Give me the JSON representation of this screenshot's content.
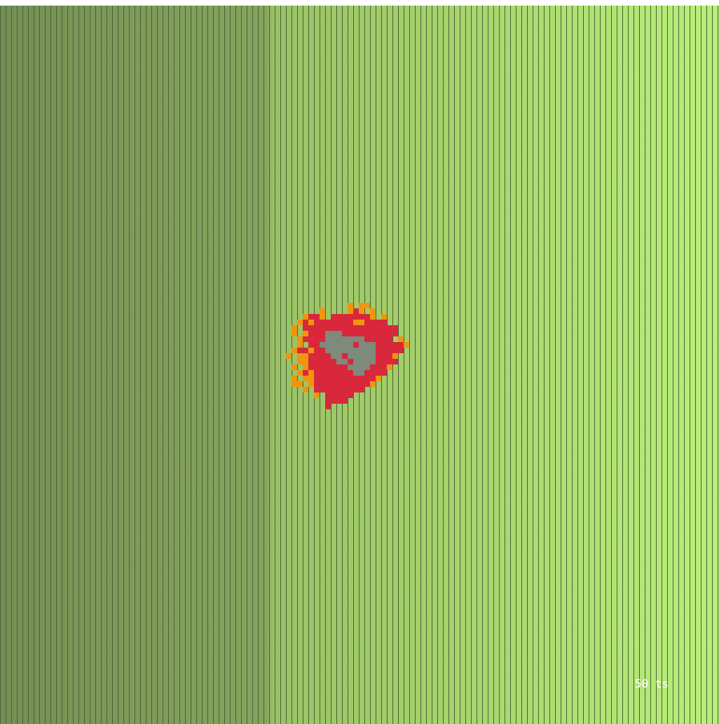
{
  "status": {
    "ticks": "50 ts"
  },
  "fire_grid": {
    "rows": [
      "............O.OO........",
      ".......O....ORO.O.......",
      "....ORRO.RRRRRRRO.O.....",
      "...ORORRRRRRROORRRR.....",
      "..O.RRRRRRRRRRRRRRRRR...",
      "..O.ORRRAAARRRRRRRRRR...",
      "...ORRRRAAAAAAARRRRR.O..",
      "...O.RRAAAAAARAAARRRRRO.",
      "..ORRORRAAAAAAAAARRRRR..",
      ".O.OORRRRAARAAAAARRRO...",
      "...OORRRRRAARAAAARRRR...",
      "..O.ORRRRRRRAAAARRRO....",
      "...ORORRRRRRRAARRRR.....",
      "..O.OORRRRRRRRRRRO......",
      "..OO.ORRRRRRRRRRO.......",
      "....O.RRRRRRRRR.........",
      "......O.RRRRR...........",
      "........RRRR............",
      "........R..............."
    ]
  }
}
